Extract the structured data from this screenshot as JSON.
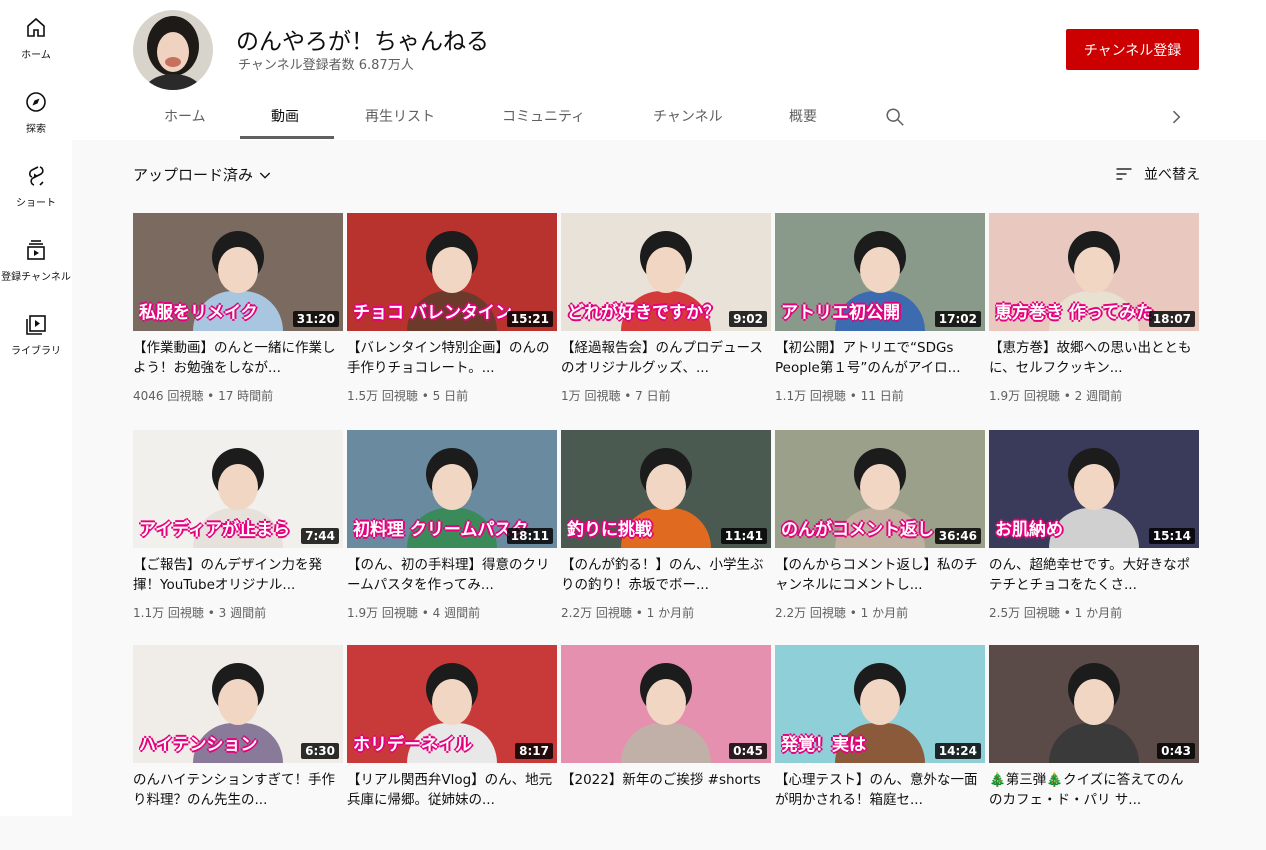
{
  "guide": {
    "items": [
      {
        "label": "ホーム",
        "icon": "home-icon"
      },
      {
        "label": "探索",
        "icon": "compass-icon"
      },
      {
        "label": "ショート",
        "icon": "shorts-icon"
      },
      {
        "label": "登録チャンネル",
        "icon": "subscriptions-icon"
      },
      {
        "label": "ライブラリ",
        "icon": "library-icon"
      }
    ]
  },
  "channel": {
    "name": "のんやろが！ちゃんねる",
    "subscribers": "チャンネル登録者数 6.87万人",
    "subscribe_label": "チャンネル登録"
  },
  "tabs": [
    {
      "label": "ホーム",
      "active": false
    },
    {
      "label": "動画",
      "active": true
    },
    {
      "label": "再生リスト",
      "active": false
    },
    {
      "label": "コミュニティ",
      "active": false
    },
    {
      "label": "チャンネル",
      "active": false
    },
    {
      "label": "概要",
      "active": false
    }
  ],
  "filter": {
    "label": "アップロード済み"
  },
  "sort": {
    "label": "並べ替え"
  },
  "colors": {
    "accent": "#cc0000",
    "caption_outline": "#e6007e"
  },
  "videos": [
    {
      "caption": "私服をリメイク",
      "duration": "31:20",
      "title": "【作業動画】のんと一緒に作業しよう！お勉強をしなが...",
      "views": "4046 回視聴",
      "age": "17 時間前",
      "bg": "#7a6a60",
      "body": "#a8c6e0"
    },
    {
      "caption": "チョコ バレンタイン",
      "duration": "15:21",
      "title": "【バレンタイン特別企画】のんの手作りチョコレート。...",
      "views": "1.5万 回視聴",
      "age": "5 日前",
      "bg": "#b8322e",
      "body": "#6b3a2a"
    },
    {
      "caption": "どれが好きですか？",
      "duration": "9:02",
      "title": "【経過報告会】のんプロデュースのオリジナルグッズ、...",
      "views": "1万 回視聴",
      "age": "7 日前",
      "bg": "#e8e2d8",
      "body": "#d43a3a"
    },
    {
      "caption": "アトリエ初公開",
      "duration": "17:02",
      "title": "【初公開】アトリエで“SDGs People第１号”のんがアイロ...",
      "views": "1.1万 回視聴",
      "age": "11 日前",
      "bg": "#8a9a8a",
      "body": "#3d6bb0"
    },
    {
      "caption": "恵方巻き 作ってみた",
      "duration": "18:07",
      "title": "【恵方巻】故郷への思い出とともに、セルフクッキン...",
      "views": "1.9万 回視聴",
      "age": "2 週間前",
      "bg": "#e9c8c0",
      "body": "#e8e0d0"
    },
    {
      "caption": "アイディアが止まら",
      "duration": "7:44",
      "title": "【ご報告】のんデザイン力を発揮！YouTubeオリジナル...",
      "views": "1.1万 回視聴",
      "age": "3 週間前",
      "bg": "#f2f0ec",
      "body": "#e6e1da"
    },
    {
      "caption": "初料理 クリームパスタ",
      "duration": "18:11",
      "title": "【のん、初の手料理】得意のクリームパスタを作ってみ...",
      "views": "1.9万 回視聴",
      "age": "4 週間前",
      "bg": "#6a8aa0",
      "body": "#3a8a5a"
    },
    {
      "caption": "釣りに挑戦",
      "duration": "11:41",
      "title": "【のんが釣る！】のん、小学生ぶりの釣り！赤坂でボー...",
      "views": "2.2万 回視聴",
      "age": "1 か月前",
      "bg": "#4a5a50",
      "body": "#e06a20"
    },
    {
      "caption": "のんがコメント返し",
      "duration": "36:46",
      "title": "【のんからコメント返し】私のチャンネルにコメントし...",
      "views": "2.2万 回視聴",
      "age": "1 か月前",
      "bg": "#9aa08a",
      "body": "#c0b0a0"
    },
    {
      "caption": "お肌納め",
      "duration": "15:14",
      "title": "のん、超絶幸せです。大好きなポテチとチョコをたくさ...",
      "views": "2.5万 回視聴",
      "age": "1 か月前",
      "bg": "#3a3a5a",
      "body": "#d0d0d0"
    },
    {
      "caption": "ハイテンション",
      "duration": "6:30",
      "title": "のんハイテンションすぎて！手作り料理？のん先生の...",
      "views": "",
      "age": "",
      "bg": "#f0ede8",
      "body": "#8a7a9a"
    },
    {
      "caption": "ホリデーネイル",
      "duration": "8:17",
      "title": "【リアル関西弁Vlog】のん、地元兵庫に帰郷。従姉妹の...",
      "views": "",
      "age": "",
      "bg": "#c83a3a",
      "body": "#e8e8e8"
    },
    {
      "caption": "",
      "duration": "0:45",
      "title": "【2022】新年のご挨拶 #shorts",
      "views": "",
      "age": "",
      "bg": "#e690b0",
      "body": "#c0b0a8"
    },
    {
      "caption": "発覚！実は",
      "duration": "14:24",
      "title": "【心理テスト】のん、意外な一面が明かされる！箱庭セ...",
      "views": "",
      "age": "",
      "bg": "#8fd0d8",
      "body": "#8a5a3a"
    },
    {
      "caption": "",
      "duration": "0:43",
      "title": "🎄第三弾🎄クイズに答えてのんのカフェ・ド・パリ サ...",
      "views": "",
      "age": "",
      "bg": "#5a4a48",
      "body": "#3a3a3a"
    }
  ]
}
